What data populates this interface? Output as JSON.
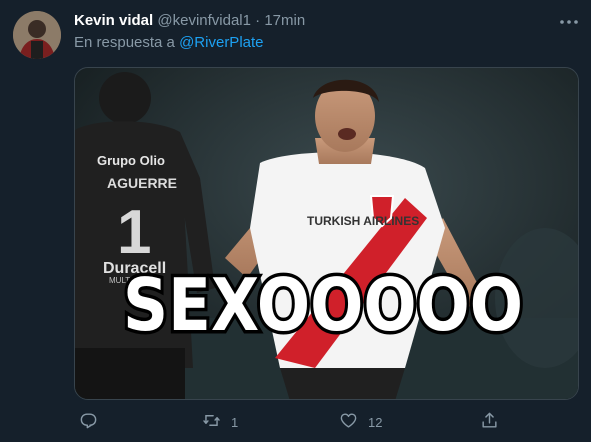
{
  "tweet": {
    "display_name": "Kevin vidal",
    "handle": "@kevinfvidal1",
    "separator": "·",
    "time": "17min",
    "reply_prefix": "En respuesta a",
    "reply_mention": "@RiverPlate",
    "media": {
      "caption_text": "SEXOOOOO",
      "shirt_left_sponsor": "Grupo Olio",
      "shirt_left_name": "AGUERRE",
      "shirt_left_number": "1",
      "shirt_left_sponsor2": "Duracell",
      "shirt_left_sponsor3": "MULTILINEA",
      "shirt_right_sponsor": "TURKISH AIRLINES"
    },
    "actions": {
      "reply_count": "",
      "retweet_count": "1",
      "like_count": "12",
      "share_count": ""
    }
  },
  "colors": {
    "background": "#15202b",
    "secondary_text": "#8899a6",
    "link": "#1da1f2",
    "divider": "#38444d"
  },
  "icons": [
    "avatar",
    "more-icon",
    "reply-icon",
    "retweet-icon",
    "like-icon",
    "share-icon"
  ]
}
